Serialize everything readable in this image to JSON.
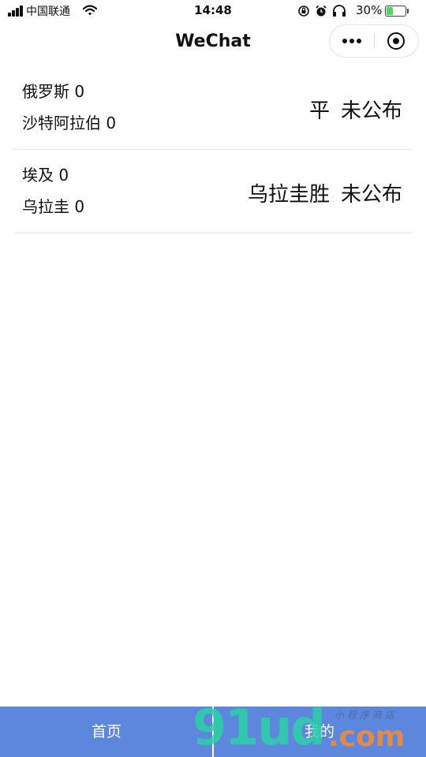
{
  "status_bar": {
    "carrier": "中国联通",
    "time": "14:48",
    "battery": "30%",
    "icons": [
      "signal-icon",
      "wifi-icon",
      "orientation-lock-icon",
      "alarm-icon",
      "headphones-icon",
      "battery-icon"
    ],
    "battery_color": "#4cd964"
  },
  "nav": {
    "title": "WeChat",
    "icons": [
      "more-icon",
      "close-mini-program-icon"
    ]
  },
  "matches": [
    {
      "home_team": "俄罗斯",
      "home_score": "0",
      "away_team": "沙特阿拉伯",
      "away_score": "0",
      "result": "平",
      "status": "未公布"
    },
    {
      "home_team": "埃及",
      "home_score": "0",
      "away_team": "乌拉圭",
      "away_score": "0",
      "result": "乌拉圭胜",
      "status": "未公布"
    }
  ],
  "tab_bar": {
    "tabs": [
      {
        "label": "首页"
      },
      {
        "label": "我的"
      }
    ],
    "background": "#5c87dd"
  },
  "watermark": {
    "main": "91ud",
    "domain": ".com",
    "sub": "小程序商店"
  }
}
